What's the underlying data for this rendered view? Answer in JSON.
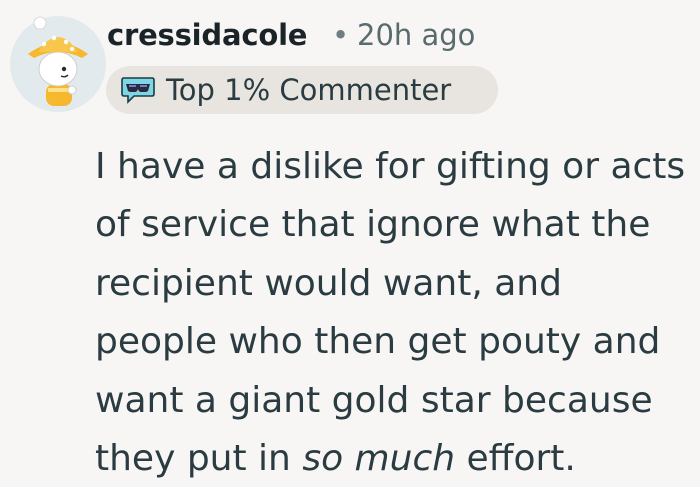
{
  "comment": {
    "author": "cressidacole",
    "separator": "•",
    "timestamp": "20h ago",
    "flair": {
      "icon": "sunglasses-speech-bubble-icon",
      "label": "Top 1% Commenter"
    },
    "body": {
      "text_before": "I have a dislike for gifting or acts of service that ignore what the recipient would want, and people who then get pouty and want a giant gold star because they put in ",
      "emphasis": "so much",
      "text_after": " effort."
    }
  },
  "colors": {
    "background": "#f8f6f4",
    "flair_background": "#e8e4df",
    "text": "#2a3c42",
    "avatar_background": "#e3eaed",
    "avatar_hat": "#f5b82e"
  }
}
